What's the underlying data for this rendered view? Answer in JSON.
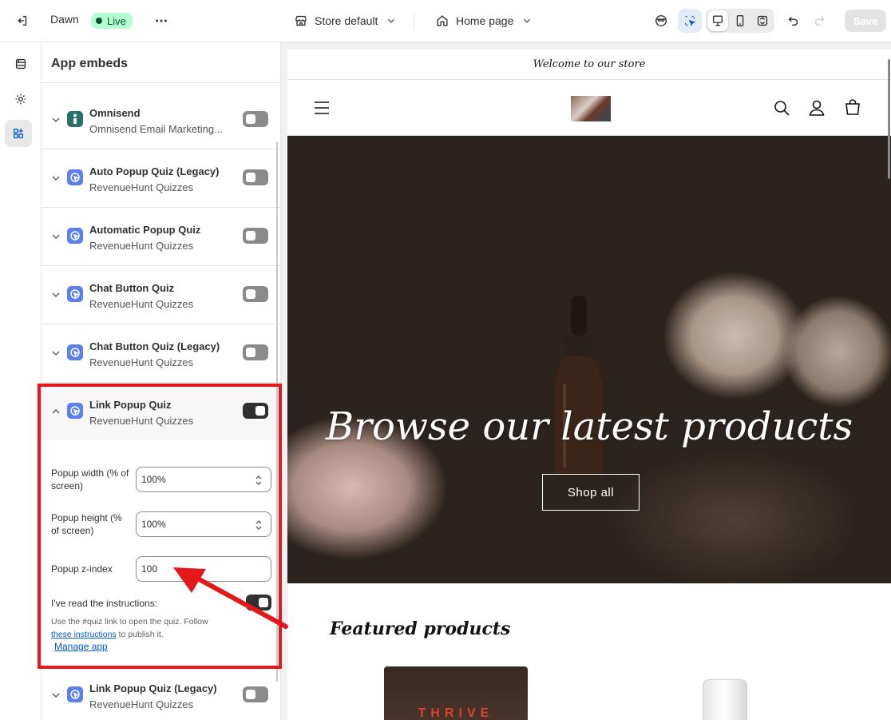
{
  "topbar": {
    "theme_name": "Dawn",
    "live_badge": "Live",
    "store_selector": "Store default",
    "page_selector": "Home page",
    "save_label": "Save"
  },
  "sidebar": {
    "title": "App embeds",
    "embeds": [
      {
        "name": "Omnisend",
        "subtitle": "Omnisend Email Marketing...",
        "enabled": false
      },
      {
        "name": "Auto Popup Quiz (Legacy)",
        "subtitle": "RevenueHunt Quizzes",
        "enabled": false
      },
      {
        "name": "Automatic Popup Quiz",
        "subtitle": "RevenueHunt Quizzes",
        "enabled": false
      },
      {
        "name": "Chat Button Quiz",
        "subtitle": "RevenueHunt Quizzes",
        "enabled": false
      },
      {
        "name": "Chat Button Quiz (Legacy)",
        "subtitle": "RevenueHunt Quizzes",
        "enabled": false
      },
      {
        "name": "Link Popup Quiz",
        "subtitle": "RevenueHunt Quizzes",
        "enabled": true
      },
      {
        "name": "Link Popup Quiz (Legacy)",
        "subtitle": "RevenueHunt Quizzes",
        "enabled": false
      }
    ],
    "settings": {
      "popup_width_label": "Popup width (% of screen)",
      "popup_width_value": "100%",
      "popup_height_label": "Popup height (% of screen)",
      "popup_height_value": "100%",
      "zindex_label": "Popup z-index",
      "zindex_value": "100",
      "instructions_label": "I've read the instructions:",
      "instructions_checked": true,
      "help_prefix": "Use the #quiz link to open the quiz. Follow",
      "help_link": "these instructions",
      "help_suffix": "to publish it.",
      "manage_app": "Manage app"
    }
  },
  "preview": {
    "announcement": "Welcome to our store",
    "hero_title": "Browse our latest products",
    "hero_button": "Shop all",
    "featured_heading": "Featured products",
    "product_label": "THRIVE"
  },
  "colors": {
    "highlight": "#e4181b",
    "live_badge_bg": "#b4fed2",
    "link": "#005bd3",
    "toggle_on": "#303030",
    "toggle_off": "#8a8a8a",
    "app_icon_revenuehunt": "#5b7ff1",
    "app_icon_omnisend": "#2c6e6a"
  }
}
